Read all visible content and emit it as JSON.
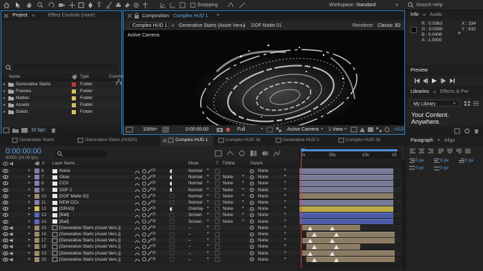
{
  "toolbar": {
    "snapping": "Snapping",
    "workspace_label": "Workspace:",
    "workspace_value": "Standard",
    "search_placeholder": "Search Help"
  },
  "project_panel": {
    "tabs": [
      "Project",
      "Effect Controls (none)"
    ],
    "search_icon": "search-icon",
    "columns": [
      "Name",
      "Type",
      "Comme"
    ],
    "items": [
      {
        "name": "Generative Starts",
        "type": "Folder",
        "color": "#c83a3a"
      },
      {
        "name": "Frames",
        "type": "Folder",
        "color": "#d8c060"
      },
      {
        "name": "Mattes",
        "type": "Folder",
        "color": "#d8c060"
      },
      {
        "name": "Assets",
        "type": "Folder",
        "color": "#d8c060"
      },
      {
        "name": "Solids",
        "type": "Folder",
        "color": "#d8c060"
      }
    ],
    "bpc": "32 bpc"
  },
  "composition_panel": {
    "title_prefix": "Composition",
    "title_name": "Complex HUD 1",
    "breadcrumbs": [
      "Complex HUD 1",
      "Generative Starts (Asset Vers.)",
      "DOF Matte 01"
    ],
    "renderer": "Renderer:",
    "renderer_value": "Classic 3D",
    "active_camera_label": "Active Camera",
    "zoom": "100%",
    "timecode": "0:00:00:00",
    "resolution": "Full",
    "camera_select": "Active Camera",
    "view_select": "1 View",
    "exposure": "+0.0"
  },
  "info_panel": {
    "tabs": [
      "Info",
      "Audio"
    ],
    "r": "R : 0.0363",
    "g": "G : 0.0390",
    "b": "B : 0.0406",
    "a": "A : 1.0000",
    "x": "X : 334",
    "y": "Y : 632"
  },
  "preview_panel": {
    "title": "Preview"
  },
  "libraries_panel": {
    "tabs": [
      "Libraries",
      "Effects & Pre"
    ],
    "library": "My Library",
    "promo_line1": "Your Content.",
    "promo_line2": "Anywhere."
  },
  "paragraph_panel": {
    "tabs": [
      "Paragraph",
      "Align"
    ],
    "fields": [
      "0 px",
      "0 px",
      "0 px",
      "0 px",
      "0 px"
    ]
  },
  "timeline": {
    "tabs": [
      "Generative Starts",
      "Generative Starts (HUDS)",
      "Complex HUD 1",
      "Complex HUD 1b",
      "Generative HUD 2",
      "Complex HUD 2b"
    ],
    "timecode": "0:00:00:00",
    "fps": "00000 (24.00 fps)",
    "columns": {
      "num": "#",
      "layer_name": "Layer Name",
      "mode": "Mode",
      "t": "T",
      "trkmat": "TrkMat",
      "parent": "Parent"
    },
    "ruler": [
      "0s",
      "05s",
      "10s",
      "15"
    ],
    "layers": [
      {
        "num": "6",
        "name": "Noise",
        "color": "#8a7fb0",
        "mode": "Normal",
        "trkmat": "",
        "parent": "None",
        "bar": "#7a7a9a"
      },
      {
        "num": "7",
        "name": "Glow",
        "color": "#8a7fb0",
        "mode": "Normal",
        "trkmat": "None",
        "parent": "None",
        "bar": "#7a7a9a"
      },
      {
        "num": "8",
        "name": "CCS",
        "color": "#8a7fb0",
        "mode": "Normal",
        "trkmat": "None",
        "parent": "None",
        "bar": "#7a7a9a"
      },
      {
        "num": "9",
        "name": "DOF 2",
        "color": "#8a7fb0",
        "mode": "Normal",
        "trkmat": "None",
        "parent": "None",
        "bar": "#7a7a9a"
      },
      {
        "num": "10",
        "name": "[DOF Matte 02]",
        "color": "#a08c6a",
        "mode": "Normal",
        "trkmat": "None",
        "parent": "None",
        "bar": "#8c7c64"
      },
      {
        "num": "11",
        "name": "NEW CCs",
        "color": "#8a7fb0",
        "mode": "Normal",
        "trkmat": "None",
        "parent": "None",
        "bar": "#7a7a9a"
      },
      {
        "num": "12",
        "name": "[GRAD]",
        "color": "#d8c060",
        "mode": "Overlay",
        "trkmat": "None",
        "parent": "None",
        "bar": "#b8a848"
      },
      {
        "num": "13",
        "name": "[Ball]",
        "color": "#5868c0",
        "mode": "Screen",
        "trkmat": "None",
        "parent": "None",
        "bar": "#4c5ca8"
      },
      {
        "num": "14",
        "name": "[Ball]",
        "color": "#5868c0",
        "mode": "Screen",
        "trkmat": "None",
        "parent": "None",
        "bar": "#4c5ca8"
      },
      {
        "num": "15",
        "name": "[Generative Starts (Asset Vers.)]",
        "color": "#a08c6a",
        "mode": "–",
        "trkmat": "",
        "parent": "None",
        "bar": "#8c7c64"
      },
      {
        "num": "16",
        "name": "[Generative Starts (Asset Vers.)]",
        "color": "#a08c6a",
        "mode": "–",
        "trkmat": "",
        "parent": "None",
        "bar": "#8c7c64"
      },
      {
        "num": "17",
        "name": "[Generative Starts (Asset Vers.)]",
        "color": "#a08c6a",
        "mode": "–",
        "trkmat": "",
        "parent": "None",
        "bar": "#8c7c64"
      },
      {
        "num": "18",
        "name": "[Generative Starts (Asset Vers.)]",
        "color": "#a08c6a",
        "mode": "–",
        "trkmat": "",
        "parent": "None",
        "bar": "#8c7c64"
      },
      {
        "num": "19",
        "name": "[Generative Starts (Asset Vers.)]",
        "color": "#a08c6a",
        "mode": "–",
        "trkmat": "",
        "parent": "None",
        "bar": "#8c7c64"
      },
      {
        "num": "20",
        "name": "[Generative Starts (Asset Vers.)]",
        "color": "#a08c6a",
        "mode": "–",
        "trkmat": "",
        "parent": "None",
        "bar": "#8c7c64"
      }
    ]
  }
}
